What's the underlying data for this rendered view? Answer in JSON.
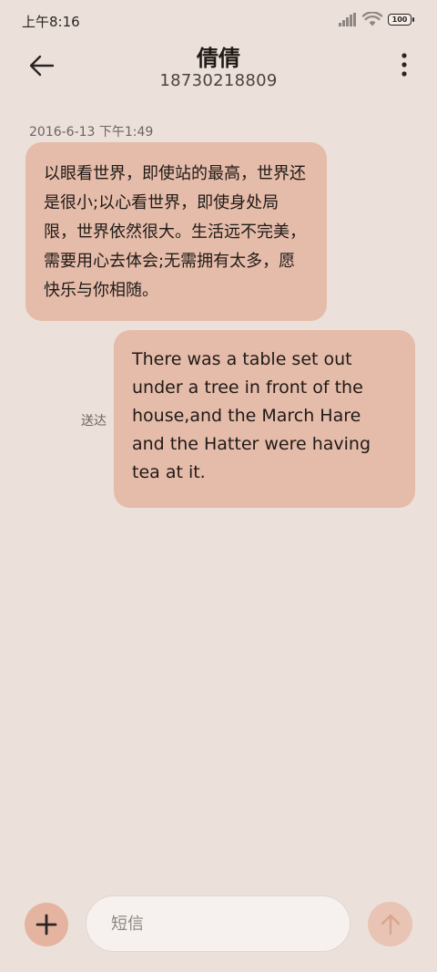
{
  "status_bar": {
    "time": "上午8:16",
    "battery": "100",
    "icons": [
      "signal-icon",
      "wifi-icon",
      "battery-icon"
    ]
  },
  "header": {
    "contact_name": "倩倩",
    "contact_number": "18730218809",
    "icons": [
      "back-arrow-icon",
      "more-vertical-icon"
    ]
  },
  "conversation": {
    "timestamp": "2016-6-13 下午1:49",
    "incoming_message": "以眼看世界，即使站的最高，世界还是很小;以心看世界，即使身处局限，世界依然很大。生活远不完美，需要用心去体会;无需拥有太多，愿快乐与你相随。",
    "outgoing_message": "There was a table set out under a tree in front of the house,and the March Hare and the Hatter were having tea at it.",
    "outgoing_status": "送达"
  },
  "composer": {
    "placeholder": "短信",
    "value": "",
    "icons": [
      "plus-icon",
      "send-arrow-icon"
    ]
  },
  "colors": {
    "background": "#ebe0da",
    "bubble": "#e5bba9",
    "add_button": "#e4b4a0",
    "send_button": "#e9c4b4",
    "input_background": "#f6f1ee"
  }
}
